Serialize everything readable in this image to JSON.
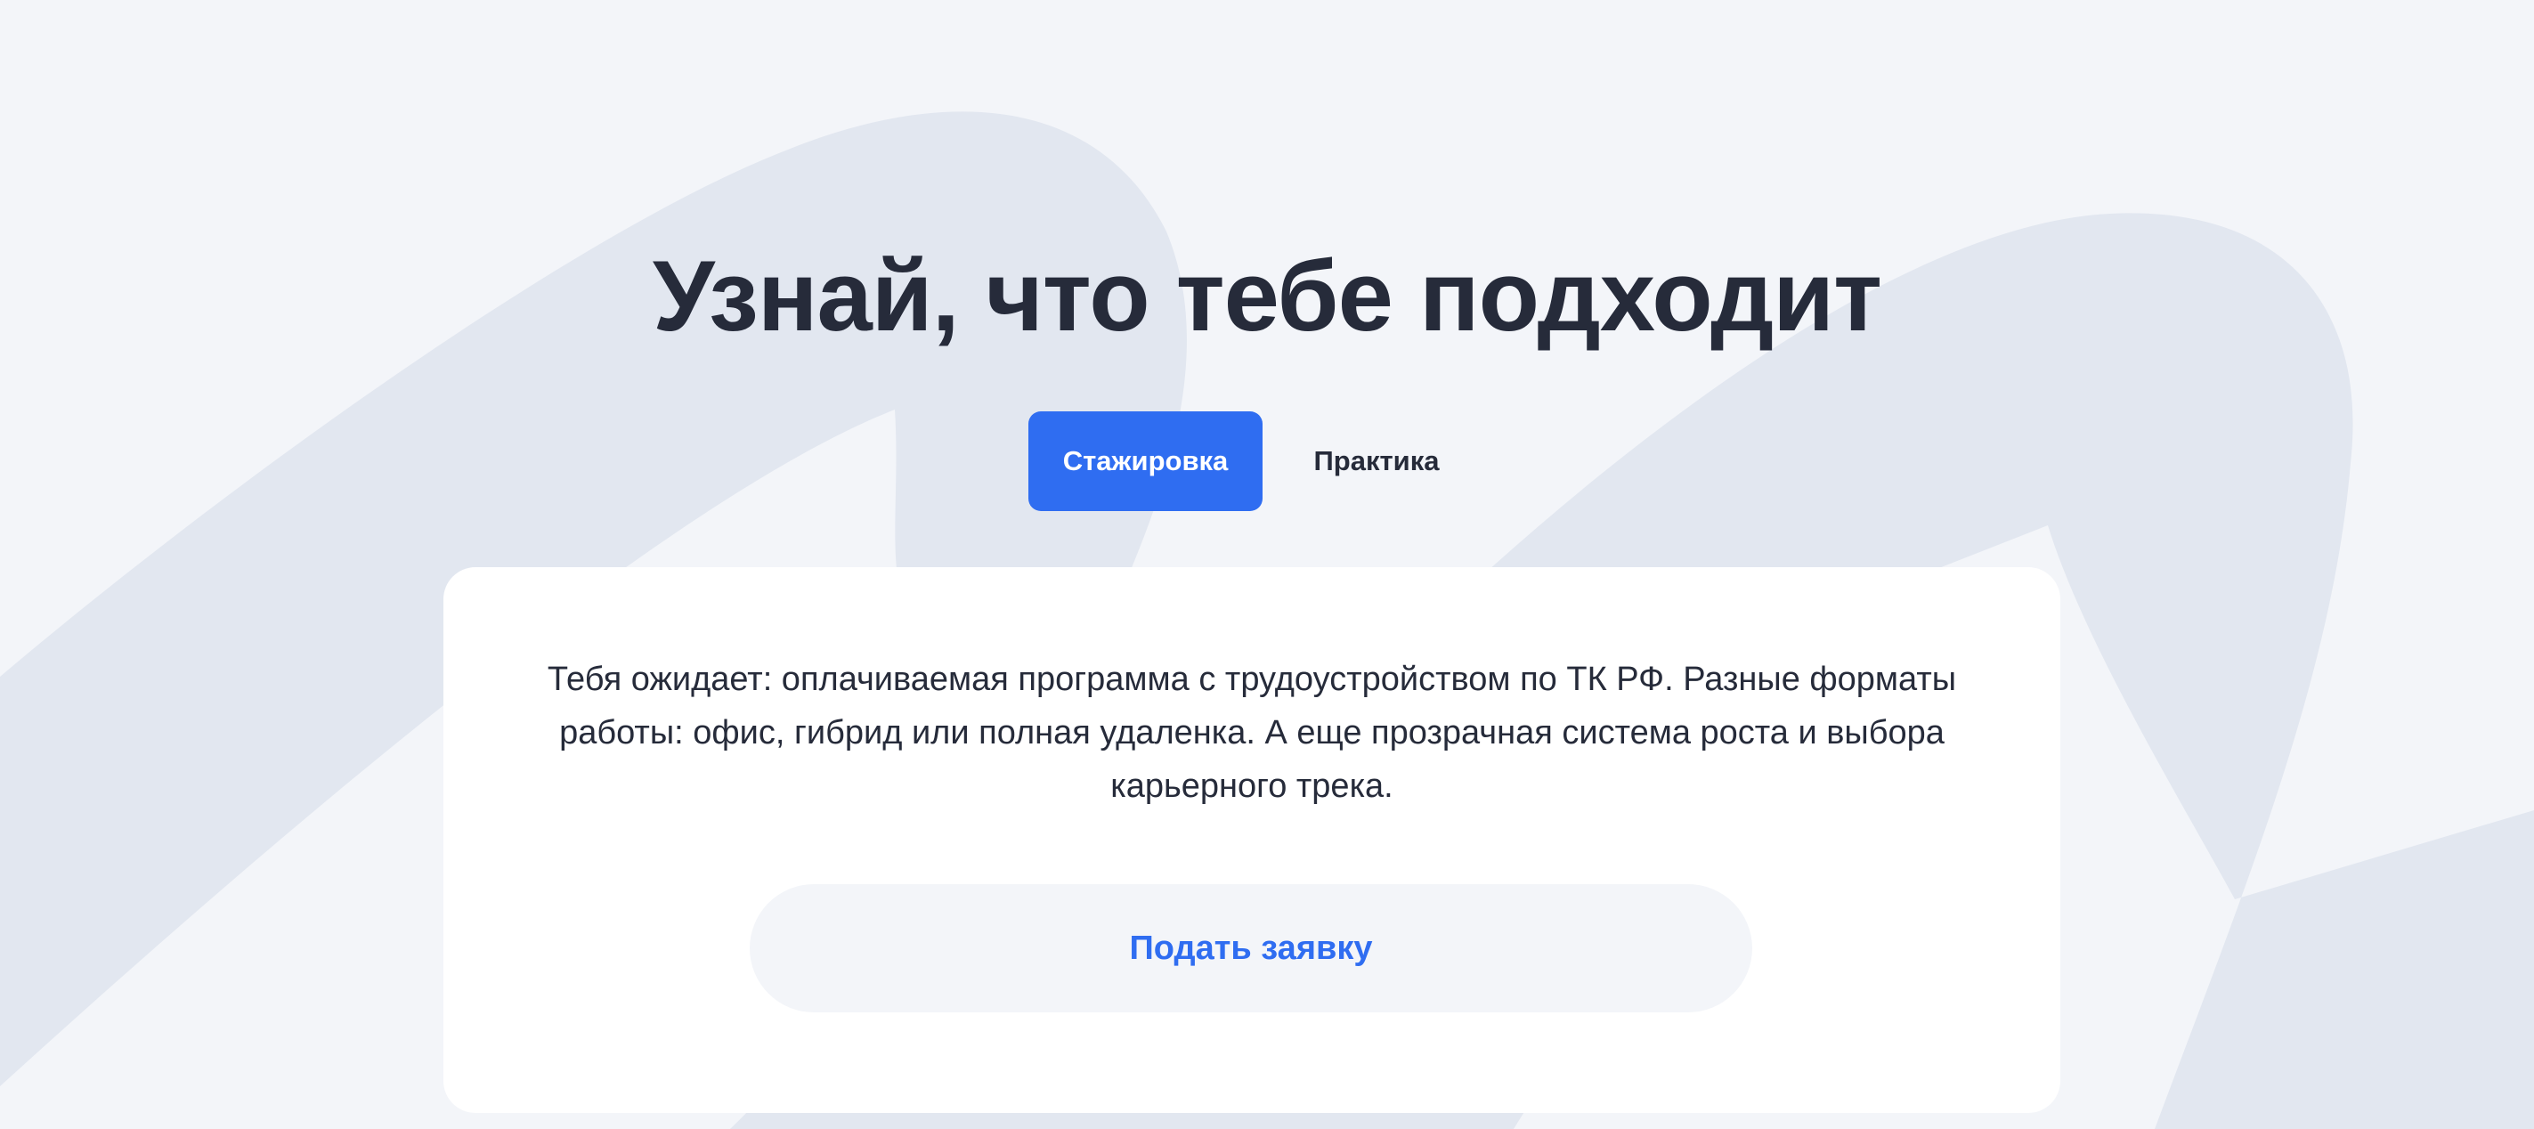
{
  "hero": {
    "title": "Узнай, что тебе подходит"
  },
  "tabs": [
    {
      "label": "Стажировка",
      "active": true
    },
    {
      "label": "Практика",
      "active": false
    }
  ],
  "card": {
    "description": "Тебя ожидает: оплачиваемая программа с трудоустройством по ТК РФ. Разные форматы работы: офис, гибрид или полная удаленка. А еще прозрачная система роста и выбора карьерного трека.",
    "button_label": "Подать заявку"
  },
  "colors": {
    "background": "#f3f5f9",
    "background_shape": "#e2e7f0",
    "accent": "#2f6df1",
    "text": "#262b3a",
    "card": "#ffffff"
  }
}
